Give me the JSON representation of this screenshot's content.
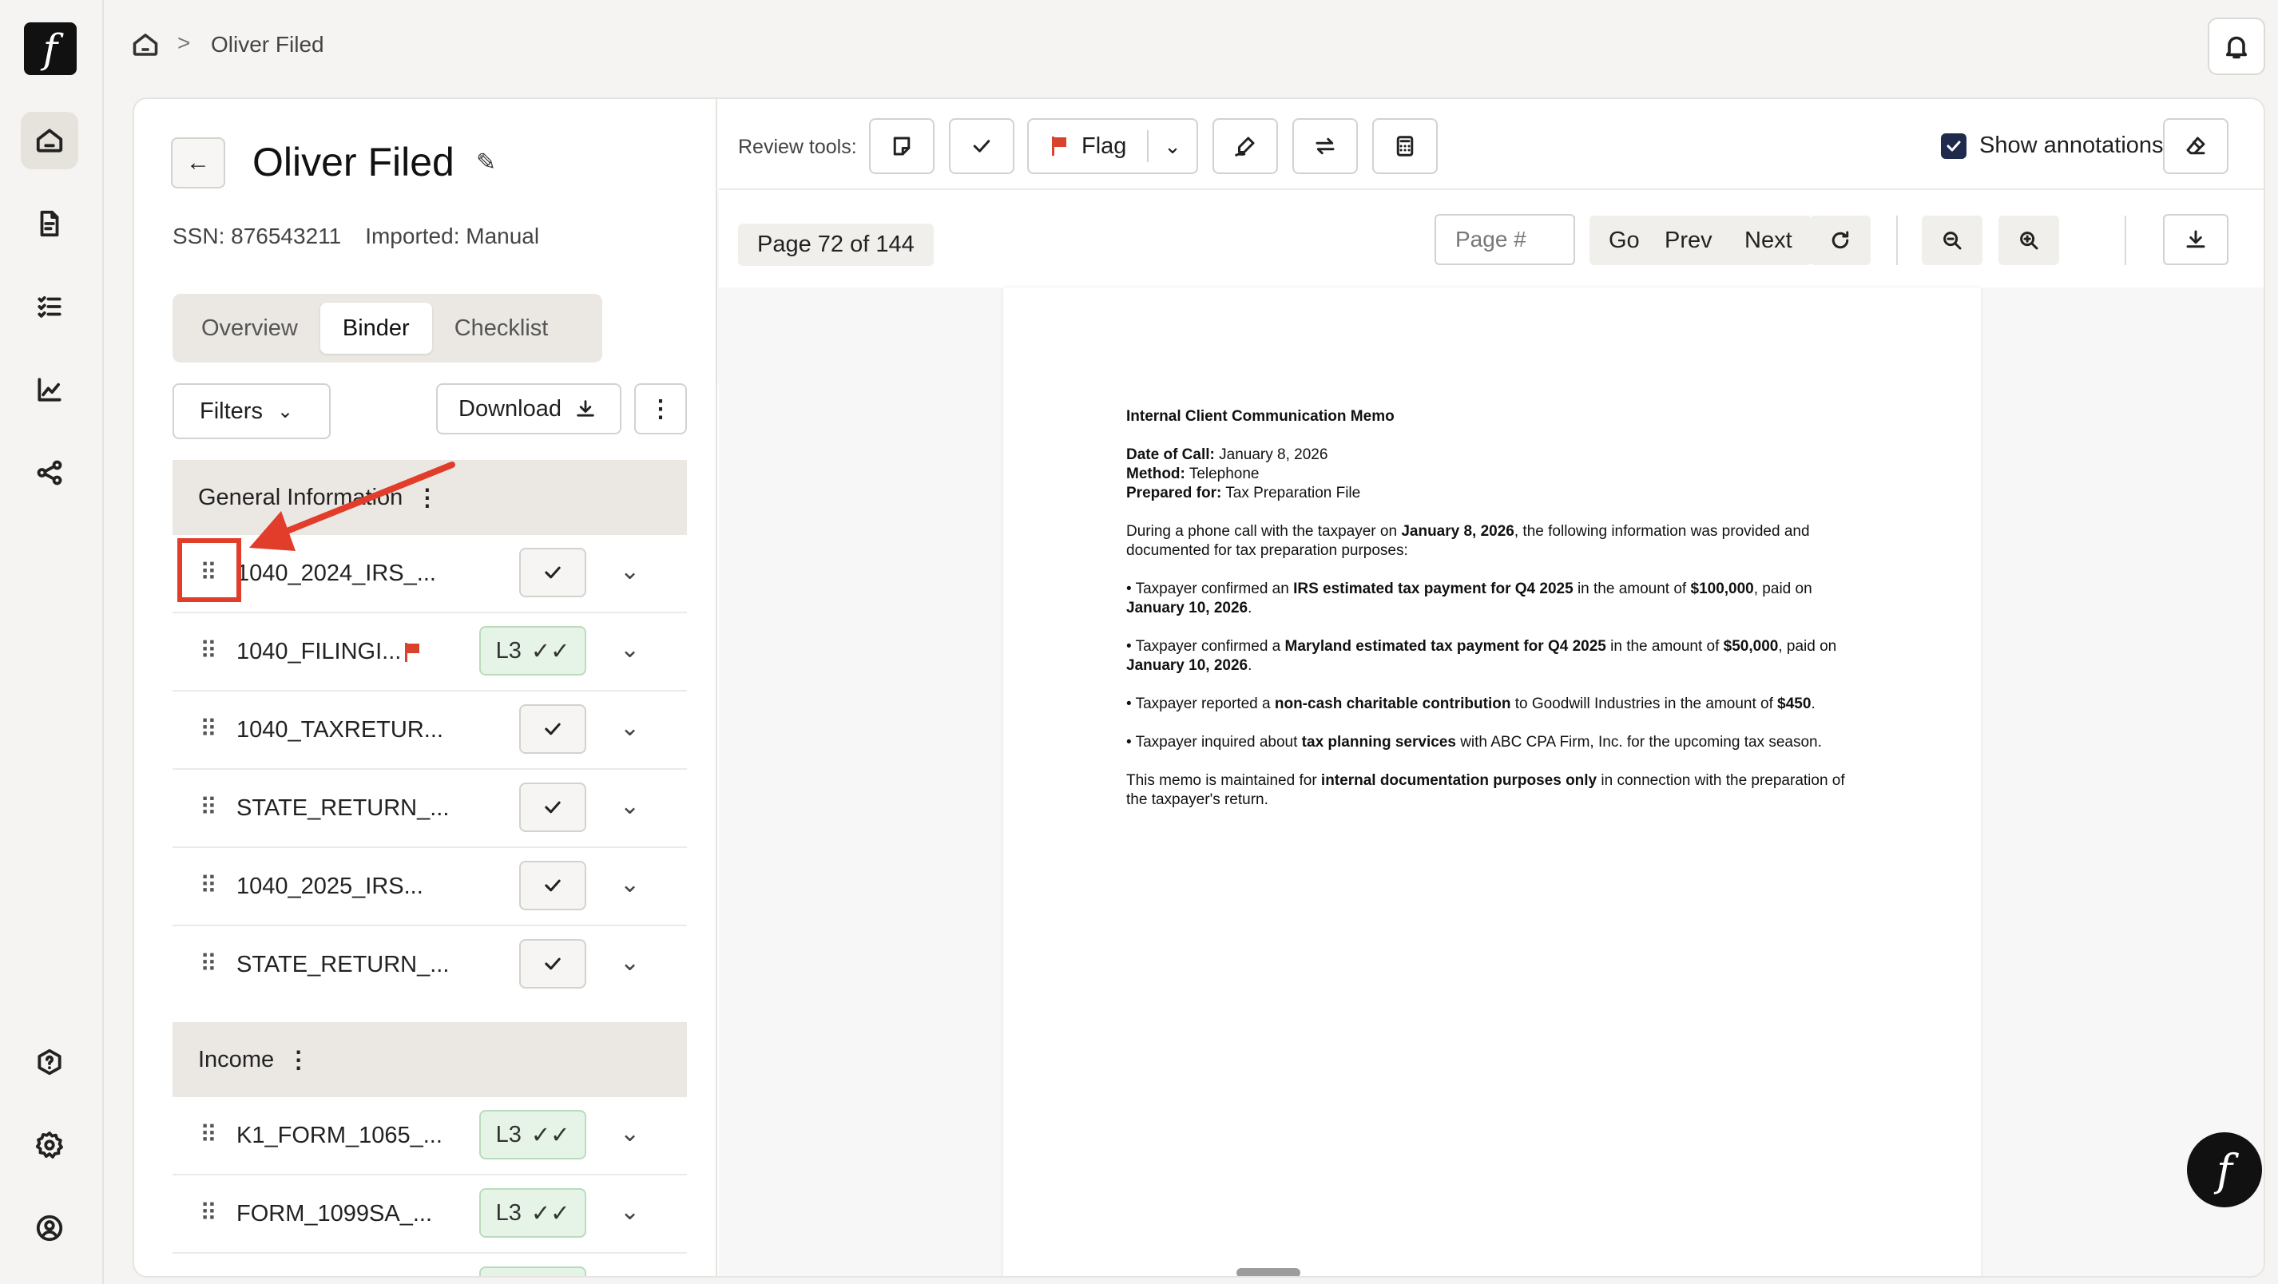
{
  "breadcrumb": {
    "name": "Oliver Filed",
    "separator": ">"
  },
  "client": {
    "name": "Oliver Filed",
    "ssn": "SSN: 876543211",
    "imported": "Imported: Manual"
  },
  "tabs": [
    "Overview",
    "Binder",
    "Checklist"
  ],
  "active_tab": "Binder",
  "list_toolbar": {
    "filters": "Filters",
    "download": "Download"
  },
  "sections": [
    {
      "title": "General Information",
      "rows": [
        {
          "name": "1040_2024_IRS_...",
          "status": "check"
        },
        {
          "name": "1040_FILINGI...",
          "status": "L3",
          "flagged": true
        },
        {
          "name": "1040_TAXRETUR...",
          "status": "check"
        },
        {
          "name": "STATE_RETURN_...",
          "status": "check"
        },
        {
          "name": "1040_2025_IRS...",
          "status": "check"
        },
        {
          "name": "STATE_RETURN_...",
          "status": "check"
        }
      ]
    },
    {
      "title": "Income",
      "rows": [
        {
          "name": "K1_FORM_1065_...",
          "status": "L3"
        },
        {
          "name": "FORM_1099SA_...",
          "status": "L3"
        }
      ]
    }
  ],
  "review": {
    "label": "Review tools:",
    "flag": "Flag",
    "show_annotations": "Show annotations",
    "show_annotations_checked": true
  },
  "pager": {
    "indicator": "Page 72 of 144",
    "placeholder": "Page #",
    "go": "Go",
    "prev": "Prev",
    "next": "Next"
  },
  "document": {
    "title": "Internal Client Communication Memo",
    "date_label": "Date of Call:",
    "date_value": "January 8, 2026",
    "method_label": "Method:",
    "method_value": "Telephone",
    "prepared_label": "Prepared for:",
    "prepared_value": "Tax Preparation File",
    "intro_a": "During a phone call with the taxpayer on ",
    "intro_b": "January 8, 2026",
    "intro_c": ", the following information was provided and documented for tax preparation purposes:",
    "b1_a": "• Taxpayer confirmed an ",
    "b1_b": "IRS estimated tax payment for Q4 2025",
    "b1_c": " in the amount of ",
    "b1_d": "$100,000",
    "b1_e": ", paid on ",
    "b1_f": "January 10, 2026",
    "b1_g": ".",
    "b2_a": "• Taxpayer confirmed a ",
    "b2_b": "Maryland estimated tax payment for Q4 2025",
    "b2_c": " in the amount of ",
    "b2_d": "$50,000",
    "b2_e": ", paid on ",
    "b2_f": "January 10, 2026",
    "b2_g": ".",
    "b3_a": "• Taxpayer reported a ",
    "b3_b": "non-cash charitable contribution",
    "b3_c": " to Goodwill Industries in the amount of ",
    "b3_d": "$450",
    "b3_e": ".",
    "b4_a": "• Taxpayer inquired about ",
    "b4_b": "tax planning services",
    "b4_c": " with ABC CPA Firm, Inc. for the upcoming tax season.",
    "close_a": "This memo is maintained for ",
    "close_b": "internal documentation purposes only",
    "close_c": " in connection with the preparation of the taxpayer's return."
  },
  "logo_glyph": "f",
  "colors": {
    "accent_red": "#e23d2b",
    "flag_red": "#d9432b",
    "level_green_bg": "#e6f4e7",
    "checkbox_navy": "#1f2b4d"
  },
  "icons": [
    "home-icon",
    "document-icon",
    "checklist-icon",
    "chart-icon",
    "share-icon",
    "help-icon",
    "settings-icon",
    "account-icon",
    "bell-icon"
  ]
}
